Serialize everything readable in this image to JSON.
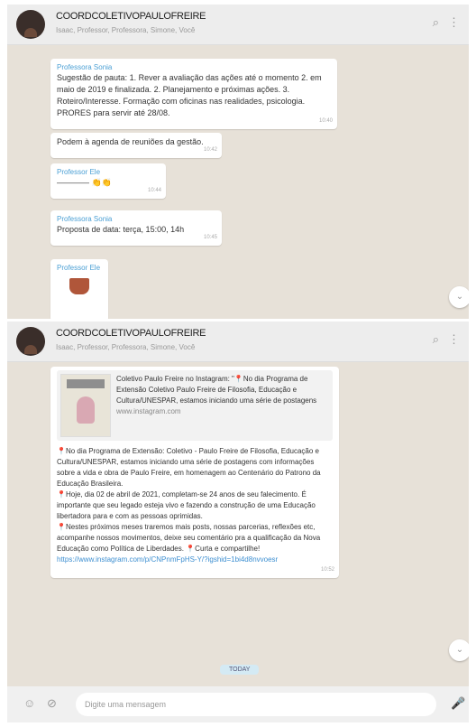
{
  "panel1": {
    "header": {
      "name": "COORDCOLETIVOPAULOFREIRE",
      "subtitle": "Isaac, Professor, Professora, Simone, Você",
      "icons": [
        "search-icon",
        "menu-icon"
      ]
    },
    "messages": [
      {
        "sender": "Professora Sonia",
        "text": "Sugestão de pauta: 1. Rever a avaliação das ações até o momento 2. em maio de 2019 e finalizada. 2. Planejamento e próximas ações. 3. Roteiro/Interesse. Formação com oficinas nas realidades, psicologia. PRORES para servir até 28/08.",
        "time": "10:40"
      },
      {
        "sender": "",
        "text": "Podem à agenda de reuniões da gestão.",
        "time": "10:42"
      },
      {
        "sender": "Professor Ele",
        "text": "———— 👏👏",
        "time": "10:44"
      },
      {
        "sender": "Professora Sonia",
        "text": "Proposta de data: terça, 15:00, 14h",
        "time": "10:45"
      },
      {
        "sender": "Professor Ele",
        "text": "",
        "time": ""
      }
    ],
    "scroll_icon": "chevron-down-icon"
  },
  "panel2": {
    "header": {
      "name": "COORDCOLETIVOPAULOFREIRE",
      "subtitle": "Isaac, Professor, Professora, Simone, Você",
      "icons": [
        "search-icon",
        "menu-icon"
      ]
    },
    "link_preview": {
      "text": "Coletivo Paulo Freire no Instagram: \"📍No dia Programa de Extensão Coletivo Paulo Freire de Filosofia, Educação e Cultura/UNESPAR, estamos iniciando uma série de postagens",
      "url": "www.instagram.com"
    },
    "paragraphs": [
      "📍No dia Programa de Extensão: Coletivo - Paulo Freire de Filosofia, Educação e Cultura/UNESPAR, estamos iniciando uma série de postagens com informações sobre a vida e obra de Paulo Freire, em homenagem ao Centenário do Patrono da Educação Brasileira.",
      "📍Hoje, dia 02 de abril de 2021, completam-se 24 anos de seu falecimento. É importante que seu legado esteja vivo e fazendo a construção de uma Educação libertadora para e com as pessoas oprimidas.",
      "📍Nestes próximos meses traremos mais posts, nossas parcerias, reflexões etc, acompanhe nossos movimentos, deixe seu comentário pra a qualificação da Nova Educação como Política de Liberdades. 📍Curta e compartilhe!"
    ],
    "link": "https://www.instagram.com/p/CNPnmFpHS-Y/?igshid=1bi4d8nvvoesr",
    "time": "10:52",
    "date_chip": "TODAY",
    "input_placeholder": "Digite uma mensagem",
    "footer_icons": [
      "emoji-icon",
      "attach-icon",
      "mic-icon"
    ],
    "scroll_icon": "chevron-down-icon"
  }
}
